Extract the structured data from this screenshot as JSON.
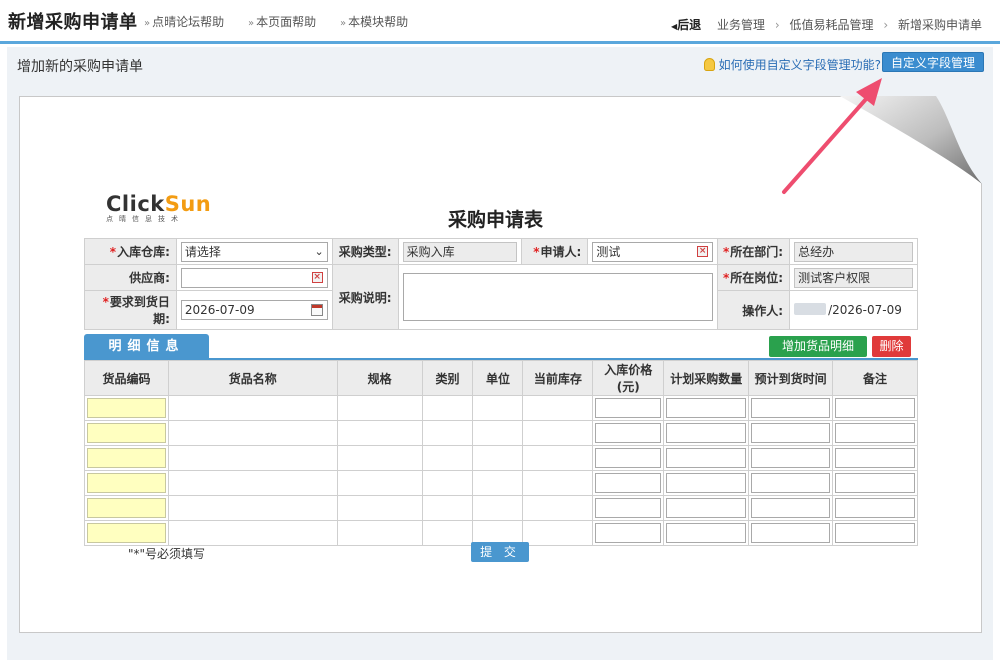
{
  "header": {
    "title": "新增采购申请单",
    "help_links": [
      "点晴论坛帮助",
      "本页面帮助",
      "本模块帮助"
    ],
    "back_label": "后退",
    "breadcrumb": [
      "业务管理",
      "低值易耗品管理",
      "新增采购申请单"
    ]
  },
  "subbar": {
    "title": "增加新的采购申请单",
    "custom_help": "如何使用自定义字段管理功能?",
    "custom_button": "自定义字段管理"
  },
  "logo": {
    "main_a": "Cli",
    "main_b": "ck",
    "main_c": "Sun",
    "sub": "点晴信息技术"
  },
  "form": {
    "title": "采购申请表",
    "warehouse_label": "入库仓库:",
    "warehouse_value": "请选择",
    "purchase_type_label": "采购类型:",
    "purchase_type_value": "采购入库",
    "applicant_label": "申请人:",
    "applicant_value": "测试",
    "dept_label": "所在部门:",
    "dept_value": "总经办",
    "supplier_label": "供应商:",
    "supplier_value": "",
    "desc_label": "采购说明:",
    "desc_value": "",
    "position_label": "所在岗位:",
    "position_value": "测试客户权限",
    "date_label": "要求到货日期:",
    "date_value": "2026-07-09",
    "operator_label": "操作人:",
    "operator_value": "/2026-07-09"
  },
  "details": {
    "tab_label": "明细信息",
    "add_button": "增加货品明细",
    "delete_button": "删除",
    "columns": [
      "货品编码",
      "货品名称",
      "规格",
      "类别",
      "单位",
      "当前库存",
      "入库价格(元)",
      "计划采购数量",
      "预计到货时间",
      "备注"
    ],
    "row_count": 6
  },
  "footer": {
    "note": "\"*\"号必须填写",
    "submit": "提 交"
  },
  "colors": {
    "accent": "#4a97cf",
    "add": "#2aa14d",
    "delete": "#e03a3a",
    "required": "#e02020"
  }
}
